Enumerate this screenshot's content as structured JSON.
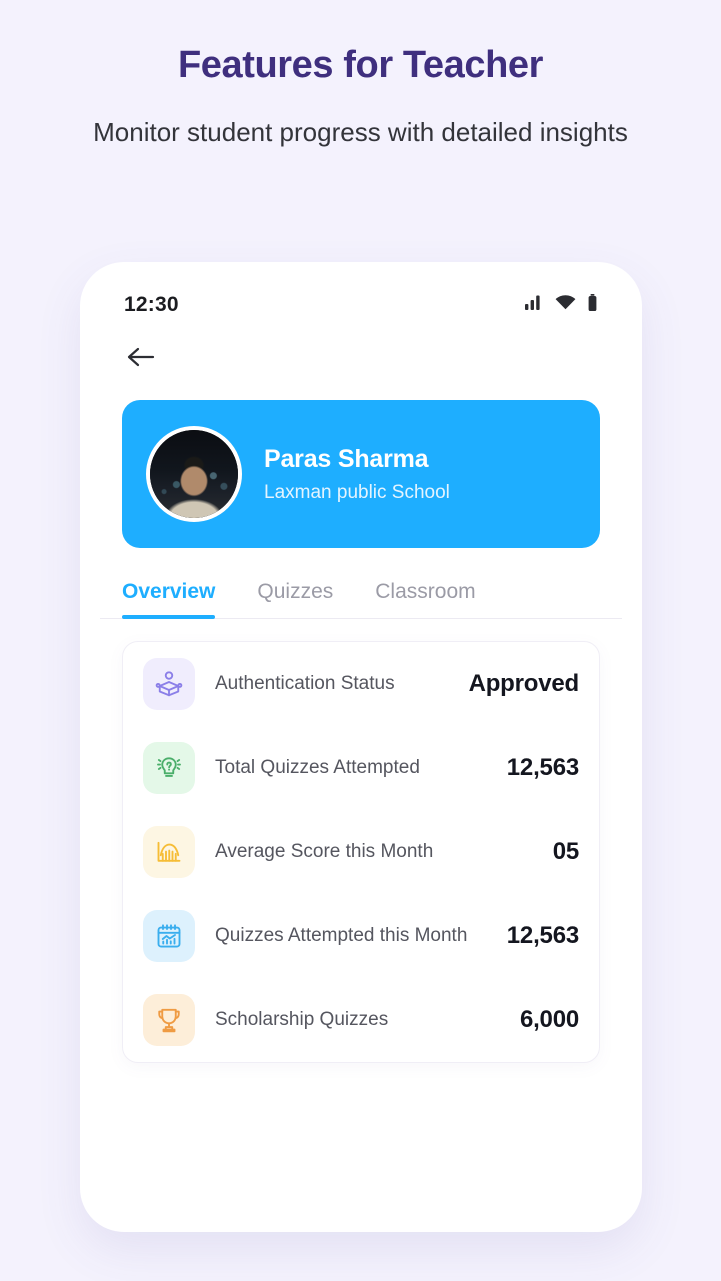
{
  "promo": {
    "title": "Features for Teacher",
    "subtitle": "Monitor student progress with detailed insights"
  },
  "phone": {
    "statusbar": {
      "time": "12:30",
      "signal_icon": "cellular-signal-icon",
      "wifi_icon": "wifi-icon",
      "battery_icon": "battery-icon"
    },
    "nav": {
      "back_icon": "back-arrow-icon"
    },
    "profile": {
      "name": "Paras Sharma",
      "school": "Laxman public School",
      "avatar_alt": "student-avatar",
      "card_color": "#1eaeff"
    },
    "tabs": [
      {
        "label": "Overview",
        "active": true
      },
      {
        "label": "Quizzes",
        "active": false
      },
      {
        "label": "Classroom",
        "active": false
      }
    ],
    "stats": [
      {
        "label": "Authentication Status",
        "value": "Approved",
        "icon": "person-reading-book-icon",
        "icon_color": "#8b7fe8",
        "icon_bg": "#f0edfd"
      },
      {
        "label": "Total Quizzes Attempted",
        "value": "12,563",
        "icon": "lightbulb-question-icon",
        "icon_color": "#4aae6a",
        "icon_bg": "#e4f8e8"
      },
      {
        "label": "Average Score this Month",
        "value": "05",
        "icon": "bar-chart-icon",
        "icon_color": "#f6bd36",
        "icon_bg": "#fdf6e3"
      },
      {
        "label": "Quizzes Attempted this Month",
        "value": "12,563",
        "icon": "calendar-chart-icon",
        "icon_color": "#3aaeee",
        "icon_bg": "#ddf1fd"
      },
      {
        "label": "Scholarship Quizzes",
        "value": "6,000",
        "icon": "trophy-icon",
        "icon_color": "#ef9b43",
        "icon_bg": "#fdeed9"
      }
    ]
  }
}
